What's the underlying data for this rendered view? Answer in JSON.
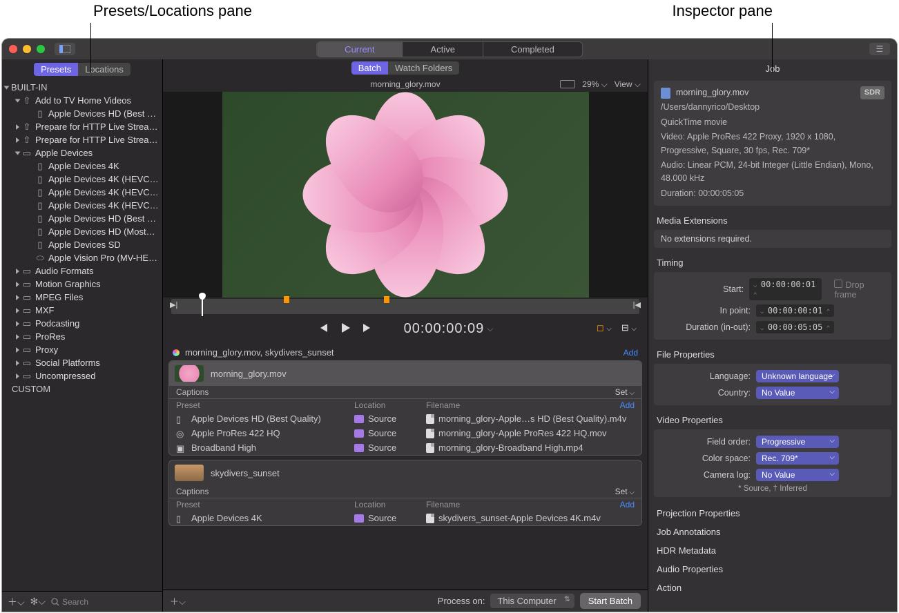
{
  "annotations": {
    "left": "Presets/Locations pane",
    "right": "Inspector pane"
  },
  "titlebar": {
    "tabs": {
      "current": "Current",
      "active": "Active",
      "completed": "Completed"
    }
  },
  "left_pane": {
    "tabs": {
      "presets": "Presets",
      "locations": "Locations"
    },
    "built_in": "BUILT-IN",
    "custom": "CUSTOM",
    "tree": {
      "add_tv": "Add to TV Home Videos",
      "add_tv_child": "Apple Devices HD (Best Q…",
      "http1": "Prepare for HTTP Live Strea…",
      "http2": "Prepare for HTTP Live Strea…",
      "apple_devices": "Apple Devices",
      "ad4k": "Apple Devices 4K",
      "ad4khevc1": "Apple Devices 4K (HEVC…",
      "ad4khevc2": "Apple Devices 4K (HEVC…",
      "ad4khevc3": "Apple Devices 4K (HEVC…",
      "adhdbest": "Apple Devices HD (Best Q…",
      "adhdmost": "Apple Devices HD (Most…",
      "adsd": "Apple Devices SD",
      "avp": "Apple Vision Pro (MV-HE…",
      "audio": "Audio Formats",
      "motion": "Motion Graphics",
      "mpeg": "MPEG Files",
      "mxf": "MXF",
      "podcasting": "Podcasting",
      "prores": "ProRes",
      "proxy": "Proxy",
      "social": "Social Platforms",
      "uncomp": "Uncompressed"
    },
    "search_placeholder": "Search"
  },
  "center": {
    "tabs": {
      "batch": "Batch",
      "watch": "Watch Folders"
    },
    "preview_file": "morning_glory.mov",
    "zoom": "29%",
    "zoom_dd": "⌵",
    "view": "View",
    "view_dd": "⌵",
    "timecode": "00:00:00:09",
    "batch_header": "morning_glory.mov, skydivers_sunset",
    "add": "Add",
    "captions": "Captions",
    "set": "Set",
    "cols": {
      "preset": "Preset",
      "location": "Location",
      "filename": "Filename"
    },
    "source": "Source",
    "job1": {
      "name": "morning_glory.mov",
      "rows": [
        {
          "preset": "Apple Devices HD (Best Quality)",
          "file": "morning_glory-Apple…s HD (Best Quality).m4v"
        },
        {
          "preset": "Apple ProRes 422 HQ",
          "file": "morning_glory-Apple ProRes 422 HQ.mov"
        },
        {
          "preset": "Broadband High",
          "file": "morning_glory-Broadband High.mp4"
        }
      ]
    },
    "job2": {
      "name": "skydivers_sunset",
      "rows": [
        {
          "preset": "Apple Devices 4K",
          "file": "skydivers_sunset-Apple Devices 4K.m4v"
        }
      ]
    },
    "footer": {
      "process_on": "Process on:",
      "computer": "This Computer",
      "start": "Start Batch"
    }
  },
  "inspector": {
    "tab": "Job",
    "file": {
      "name": "morning_glory.mov",
      "sdr": "SDR",
      "path": "/Users/dannyrico/Desktop",
      "kind": "QuickTime movie",
      "video": "Video: Apple ProRes 422 Proxy, 1920 x 1080, Progressive, Square, 30 fps, Rec. 709*",
      "audio": "Audio: Linear PCM, 24-bit Integer (Little Endian), Mono, 48.000 kHz",
      "duration": "Duration: 00:00:05:05"
    },
    "media_ext": {
      "title": "Media Extensions",
      "msg": "No extensions required."
    },
    "timing": {
      "title": "Timing",
      "start_lbl": "Start:",
      "start": "00:00:00:01",
      "in_lbl": "In point:",
      "in": "00:00:00:01",
      "dur_lbl": "Duration (in-out):",
      "dur": "00:00:05:05",
      "drop": "Drop frame"
    },
    "fileprops": {
      "title": "File Properties",
      "lang_lbl": "Language:",
      "lang": "Unknown language",
      "country_lbl": "Country:",
      "country": "No Value"
    },
    "videoprops": {
      "title": "Video Properties",
      "field_lbl": "Field order:",
      "field": "Progressive",
      "color_lbl": "Color space:",
      "color": "Rec. 709*",
      "cam_lbl": "Camera log:",
      "cam": "No Value",
      "note": "* Source, † Inferred"
    },
    "sects": {
      "proj": "Projection Properties",
      "jobann": "Job Annotations",
      "hdr": "HDR Metadata",
      "audio": "Audio Properties",
      "action": "Action"
    }
  }
}
